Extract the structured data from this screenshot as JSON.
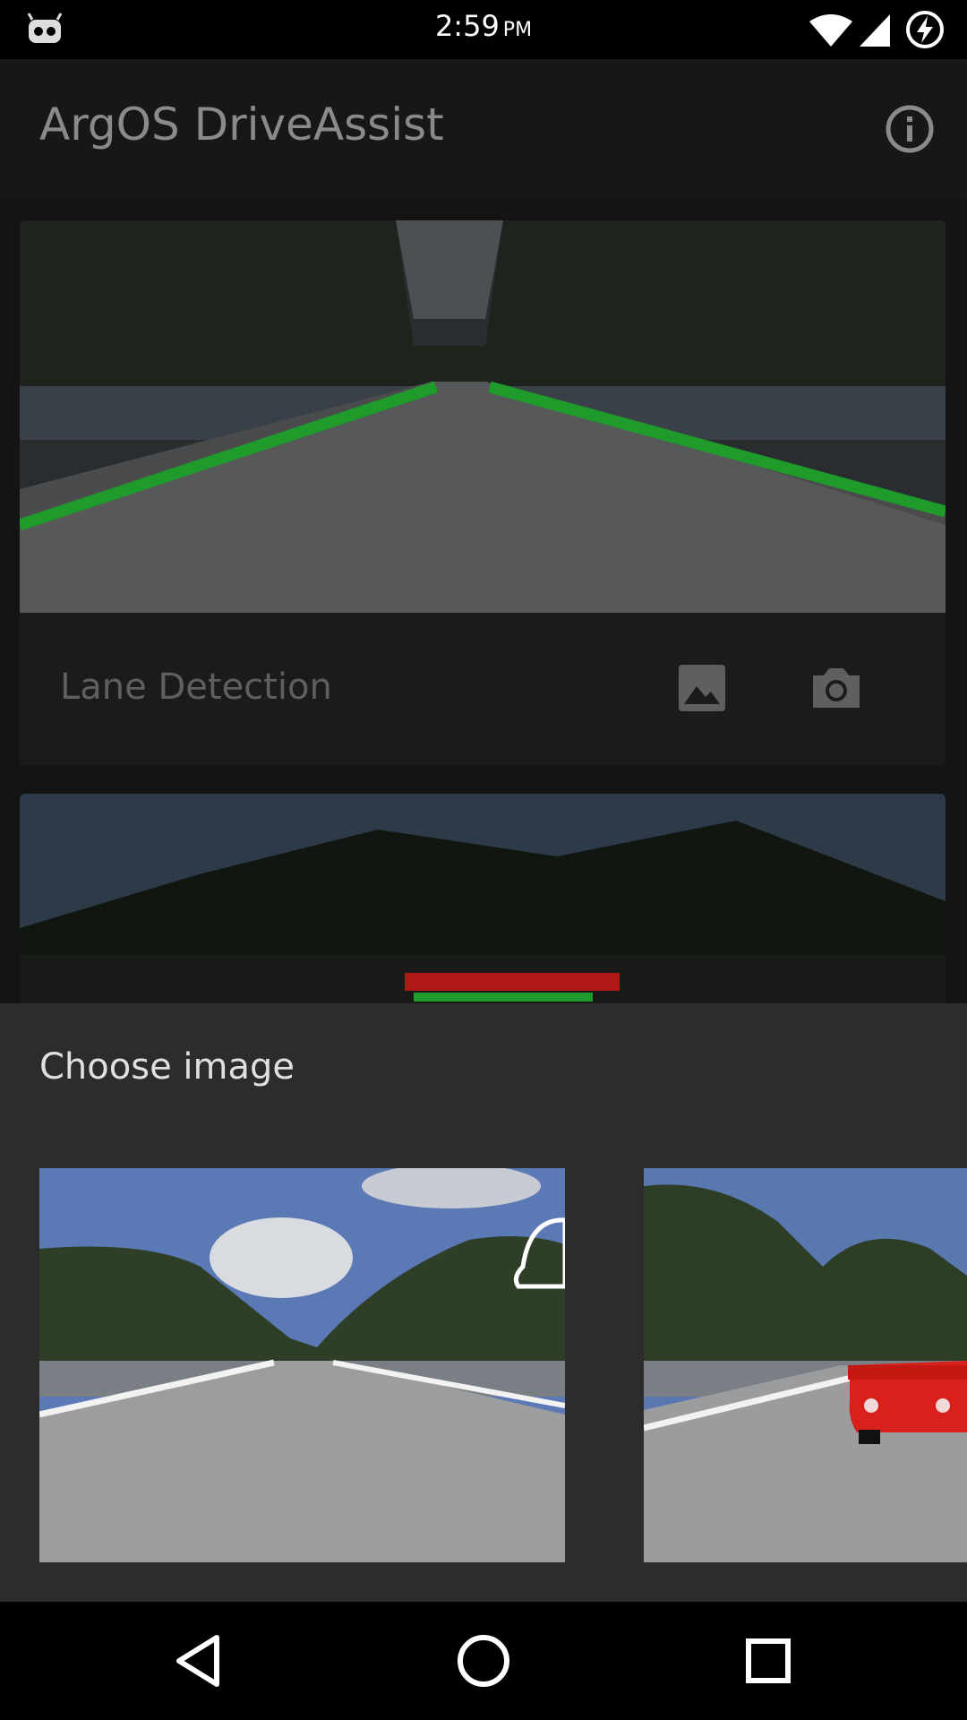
{
  "status_bar": {
    "time": "2:59",
    "ampm": "PM",
    "icons": [
      "notification-android-icon",
      "wifi-icon",
      "cell-signal-icon",
      "battery-charging-icon"
    ]
  },
  "app_bar": {
    "title": "ArgOS DriveAssist",
    "info_icon": "info-icon"
  },
  "cards": [
    {
      "title": "Lane Detection",
      "actions": [
        "gallery-icon",
        "camera-icon"
      ]
    }
  ],
  "sheet": {
    "title": "Choose image"
  },
  "nav_bar": {
    "icons": [
      "back-icon",
      "home-icon",
      "recents-icon"
    ]
  },
  "colors": {
    "lane_line": "#1e9b2a",
    "sheet_bg": "#2c2c2c",
    "app_bar_bg": "#171717"
  }
}
